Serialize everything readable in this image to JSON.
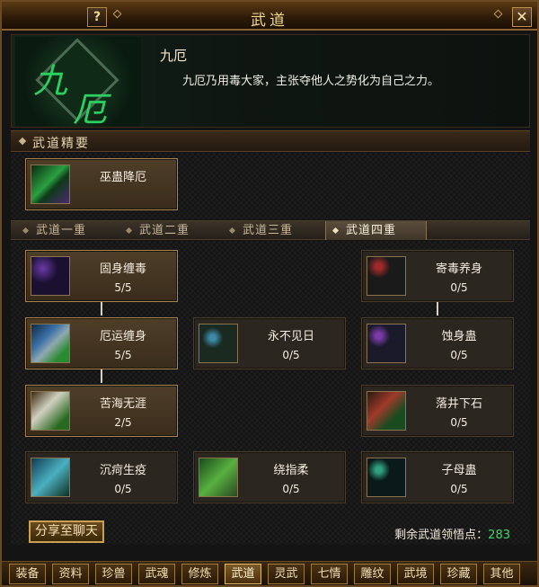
{
  "window": {
    "title": "武道",
    "help_label": "?",
    "close_label": "✕"
  },
  "header": {
    "emblem_chars": [
      "九",
      "厄"
    ],
    "skill_name": "九厄",
    "description": "九厄乃用毒大家，主张夺他人之势化为自己之力。"
  },
  "section": {
    "title": "武道精要"
  },
  "essence_card": {
    "name": "巫蛊降厄",
    "icon": "poison-snake-icon"
  },
  "tabs": [
    {
      "label": "武道一重",
      "active": false
    },
    {
      "label": "武道二重",
      "active": false
    },
    {
      "label": "武道三重",
      "active": false
    },
    {
      "label": "武道四重",
      "active": true
    }
  ],
  "skills": [
    {
      "name": "固身缠毒",
      "level": "5/5",
      "state": "active",
      "icon": "snake-coil-icon"
    },
    {
      "name": "寄毒养身",
      "level": "0/5",
      "state": "inactive",
      "icon": "red-snake-icon"
    },
    {
      "name": "厄运缠身",
      "level": "5/5",
      "state": "active",
      "icon": "gauntlet-icon"
    },
    {
      "name": "永不见日",
      "level": "0/5",
      "state": "inactive",
      "icon": "fist-orb-icon"
    },
    {
      "name": "蚀身蛊",
      "level": "0/5",
      "state": "inactive",
      "icon": "bracer-icon"
    },
    {
      "name": "苦海无涯",
      "level": "2/5",
      "state": "active",
      "icon": "fist-strike-icon"
    },
    {
      "name": "落井下石",
      "level": "0/5",
      "state": "inactive",
      "icon": "figure-icon"
    },
    {
      "name": "沉疴生疫",
      "level": "0/5",
      "state": "inactive",
      "icon": "ice-shard-icon"
    },
    {
      "name": "绕指柔",
      "level": "0/5",
      "state": "inactive",
      "icon": "green-slash-icon"
    },
    {
      "name": "子母蛊",
      "level": "0/5",
      "state": "inactive",
      "icon": "twin-insect-icon"
    }
  ],
  "footer": {
    "share_label": "分享至聊天",
    "points_label": "剩余武道领悟点：",
    "points_value": "283"
  },
  "bottom_tabs": [
    {
      "label": "装备",
      "active": false
    },
    {
      "label": "资料",
      "active": false
    },
    {
      "label": "珍兽",
      "active": false
    },
    {
      "label": "武魂",
      "active": false
    },
    {
      "label": "修炼",
      "active": false
    },
    {
      "label": "武道",
      "active": true
    },
    {
      "label": "灵武",
      "active": false
    },
    {
      "label": "七情",
      "active": false
    },
    {
      "label": "雕纹",
      "active": false
    },
    {
      "label": "武境",
      "active": false
    },
    {
      "label": "珍藏",
      "active": false
    },
    {
      "label": "其他",
      "active": false
    }
  ],
  "colors": {
    "points_value": "#3ad86a",
    "title": "#f0d890"
  }
}
